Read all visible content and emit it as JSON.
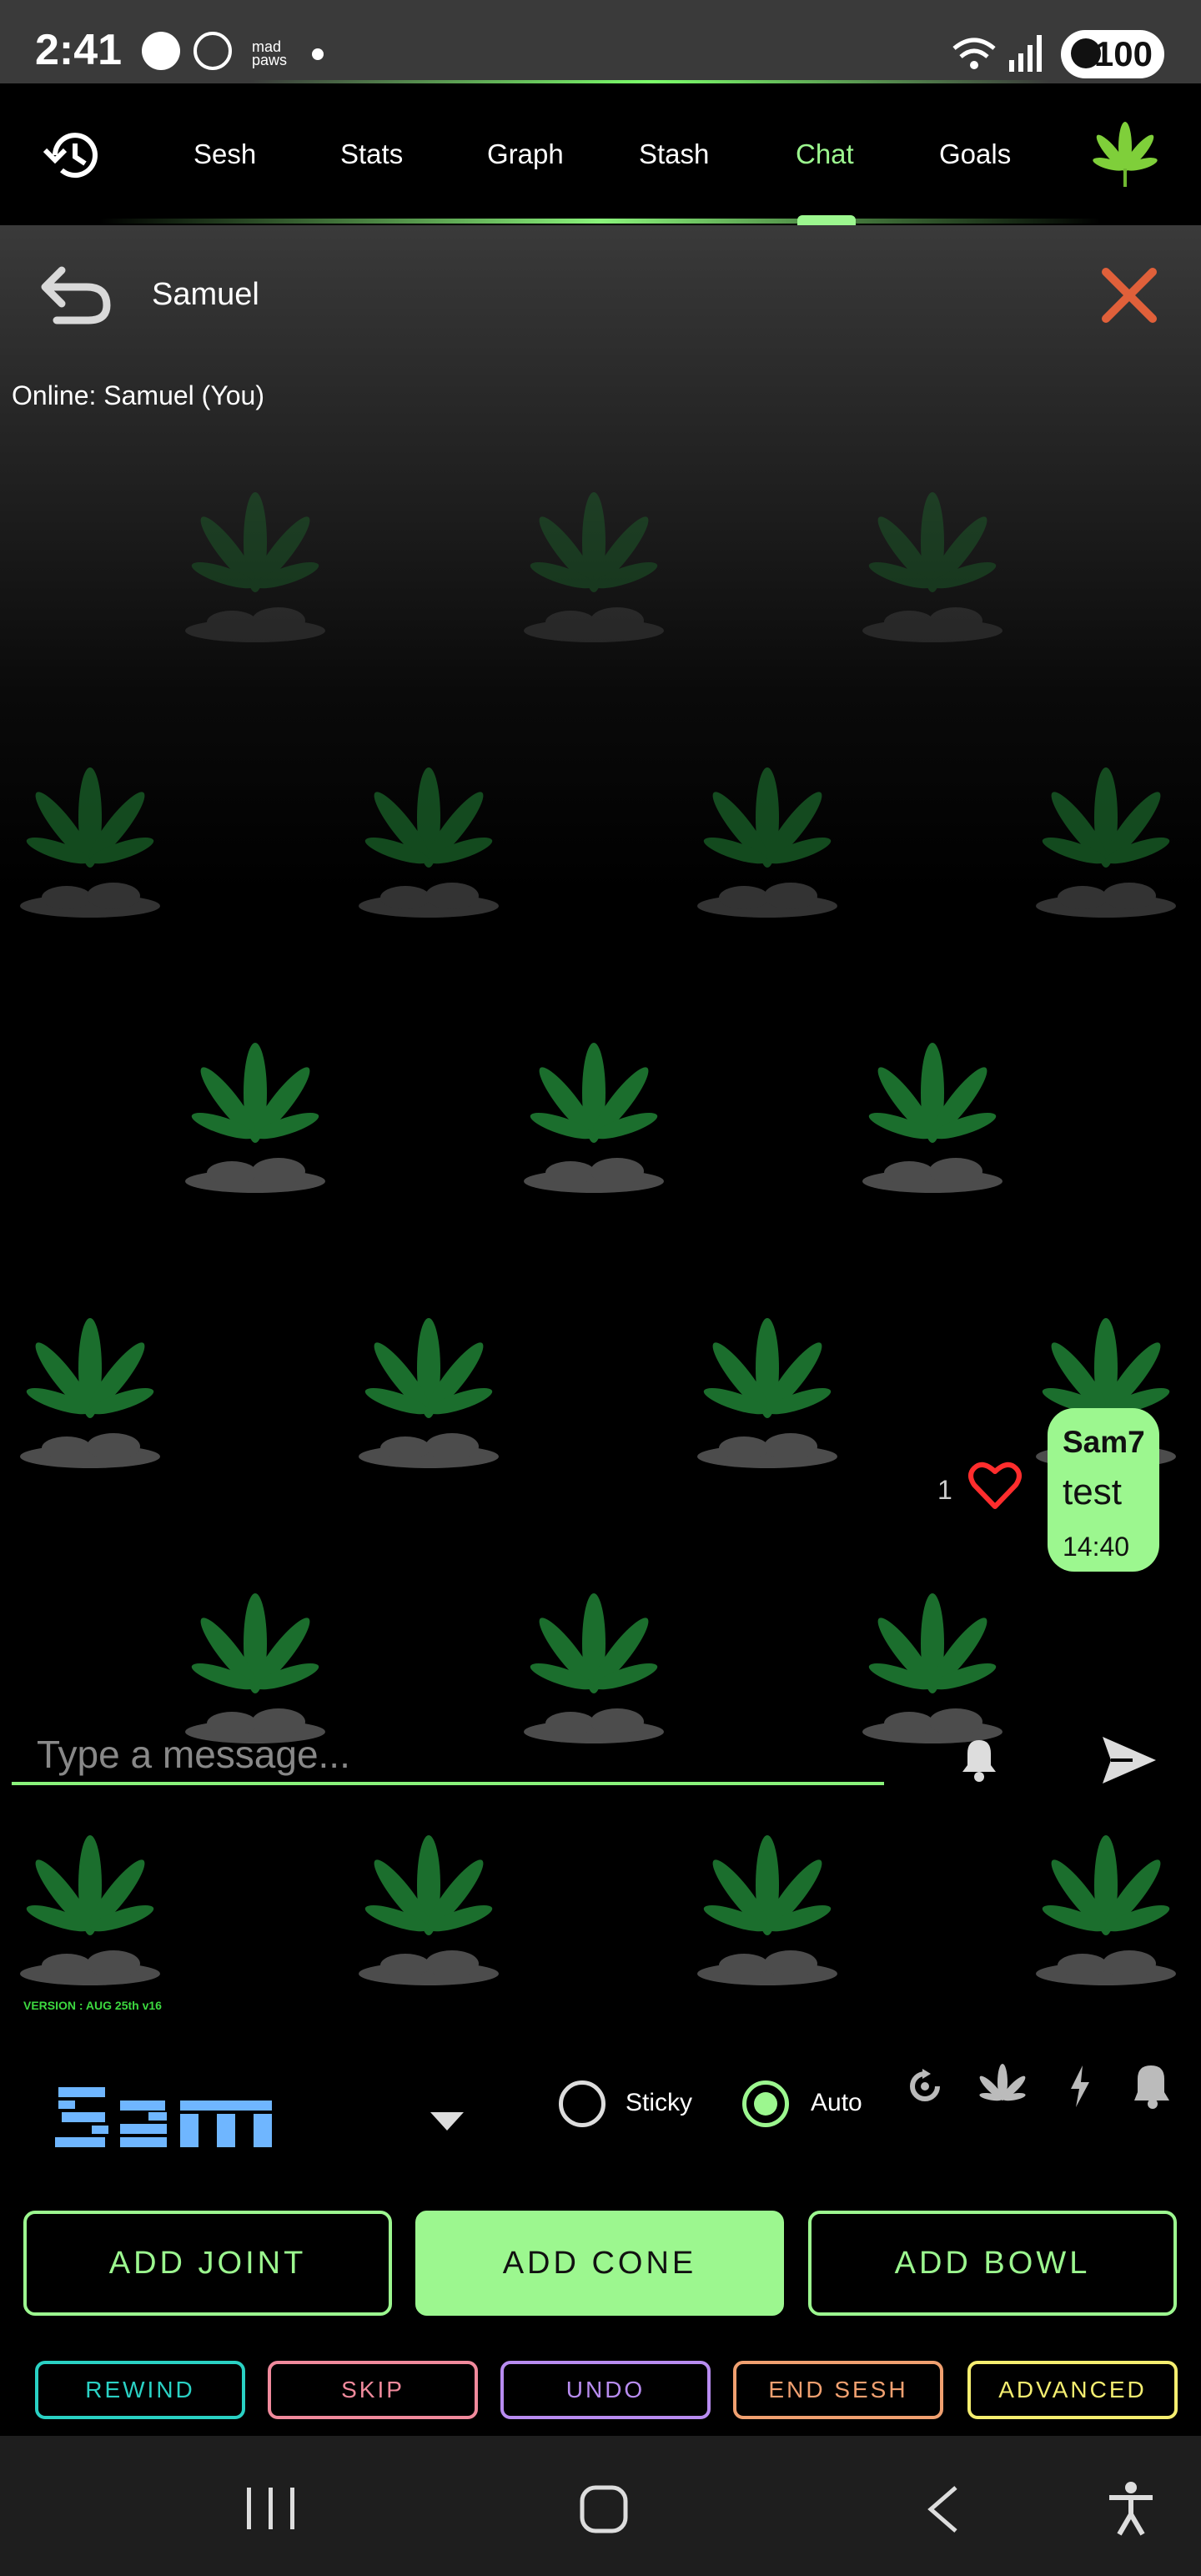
{
  "status_bar": {
    "time": "2:41",
    "battery": "100",
    "brand_tiny": "mad paws"
  },
  "tabs": [
    {
      "label": "Sesh"
    },
    {
      "label": "Stats"
    },
    {
      "label": "Graph"
    },
    {
      "label": "Stash"
    },
    {
      "label": "Chat",
      "active": true
    },
    {
      "label": "Goals"
    }
  ],
  "chat": {
    "room_title": "Samuel",
    "online_text": "Online: Samuel (You)",
    "messages": [
      {
        "sender": "Sam7",
        "text": "test",
        "time": "14:40",
        "likes": "1"
      }
    ],
    "input_placeholder": "Type a message..."
  },
  "version": "VERSION : AUG 25th v16",
  "controls": {
    "logo_text": "Sam",
    "sticky_label": "Sticky",
    "auto_label": "Auto",
    "auto_selected": true,
    "sticky_selected": false
  },
  "buttons": {
    "add_joint": "ADD JOINT",
    "add_cone": "ADD CONE",
    "add_bowl": "ADD BOWL",
    "rewind": "REWIND",
    "skip": "SKIP",
    "undo": "UNDO",
    "end_sesh": "END SESH",
    "advanced": "ADVANCED"
  },
  "colors": {
    "accent": "#9cf78f",
    "rewind": "#2ad1c4",
    "skip": "#f08a9c",
    "undo": "#b88cf0",
    "end_sesh": "#f0a070",
    "advanced": "#f5ee70",
    "close_x": "#e0603a"
  },
  "icons": [
    "history-icon",
    "weed-leaf-icon",
    "undo-arrow-icon",
    "close-icon",
    "heart-icon",
    "bell-icon",
    "send-icon",
    "dropdown-icon",
    "refresh-icon",
    "leaf-icon",
    "bolt-icon",
    "bell-outline-icon",
    "recents-icon",
    "home-icon",
    "back-icon",
    "accessibility-icon"
  ]
}
